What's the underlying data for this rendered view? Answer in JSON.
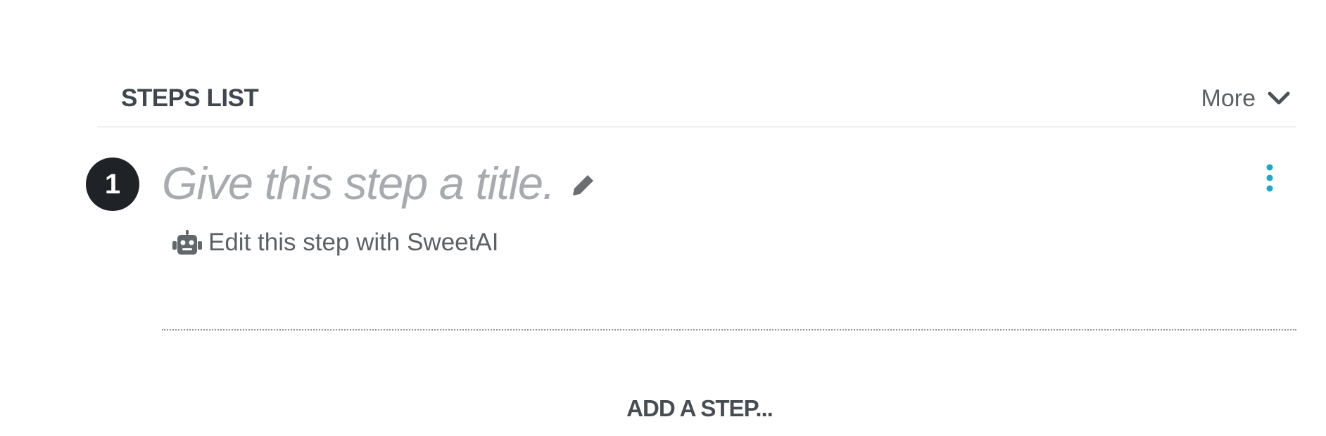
{
  "steps_list": {
    "title": "STEPS LIST",
    "more_label": "More",
    "more_icon": "chevron-down-icon"
  },
  "step": {
    "number": "1",
    "title_placeholder": "Give this step a title.",
    "title_icon": "pencil-icon",
    "menu_icon": "vertical-ellipsis-icon",
    "sweetai_icon": "robot-icon",
    "sweetai_label": "Edit this step with SweetAI"
  },
  "actions": {
    "add_step_label": "ADD A STEP..."
  },
  "colors": {
    "text_dark": "#3f464d",
    "text_placeholder": "#a7aaae",
    "step_badge": "#1f2226",
    "accent": "#1ca9c9"
  }
}
